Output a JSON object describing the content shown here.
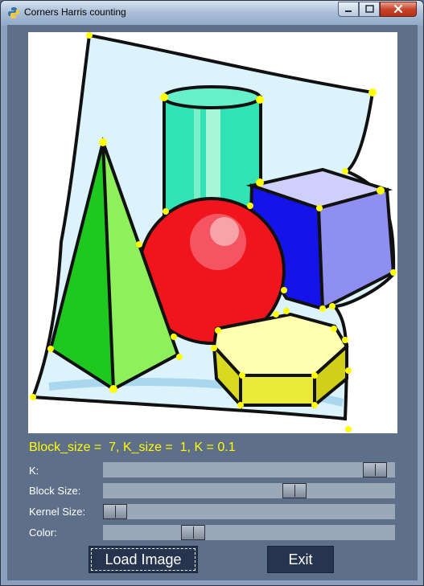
{
  "window": {
    "title": "Corners Harris counting"
  },
  "info": {
    "text": "Block_size =  7, K_size =  1, K = 0.1"
  },
  "sliders": [
    {
      "label": "K:",
      "value": 0.97
    },
    {
      "label": "Block Size:",
      "value": 0.67
    },
    {
      "label": "Kernel Size:",
      "value": 0.0
    },
    {
      "label": "Color:",
      "value": 0.29
    }
  ],
  "buttons": {
    "load": "Load Image",
    "exit": "Exit"
  },
  "colors": {
    "corner_marker": "#ffff00",
    "background": "#5e6f89"
  }
}
